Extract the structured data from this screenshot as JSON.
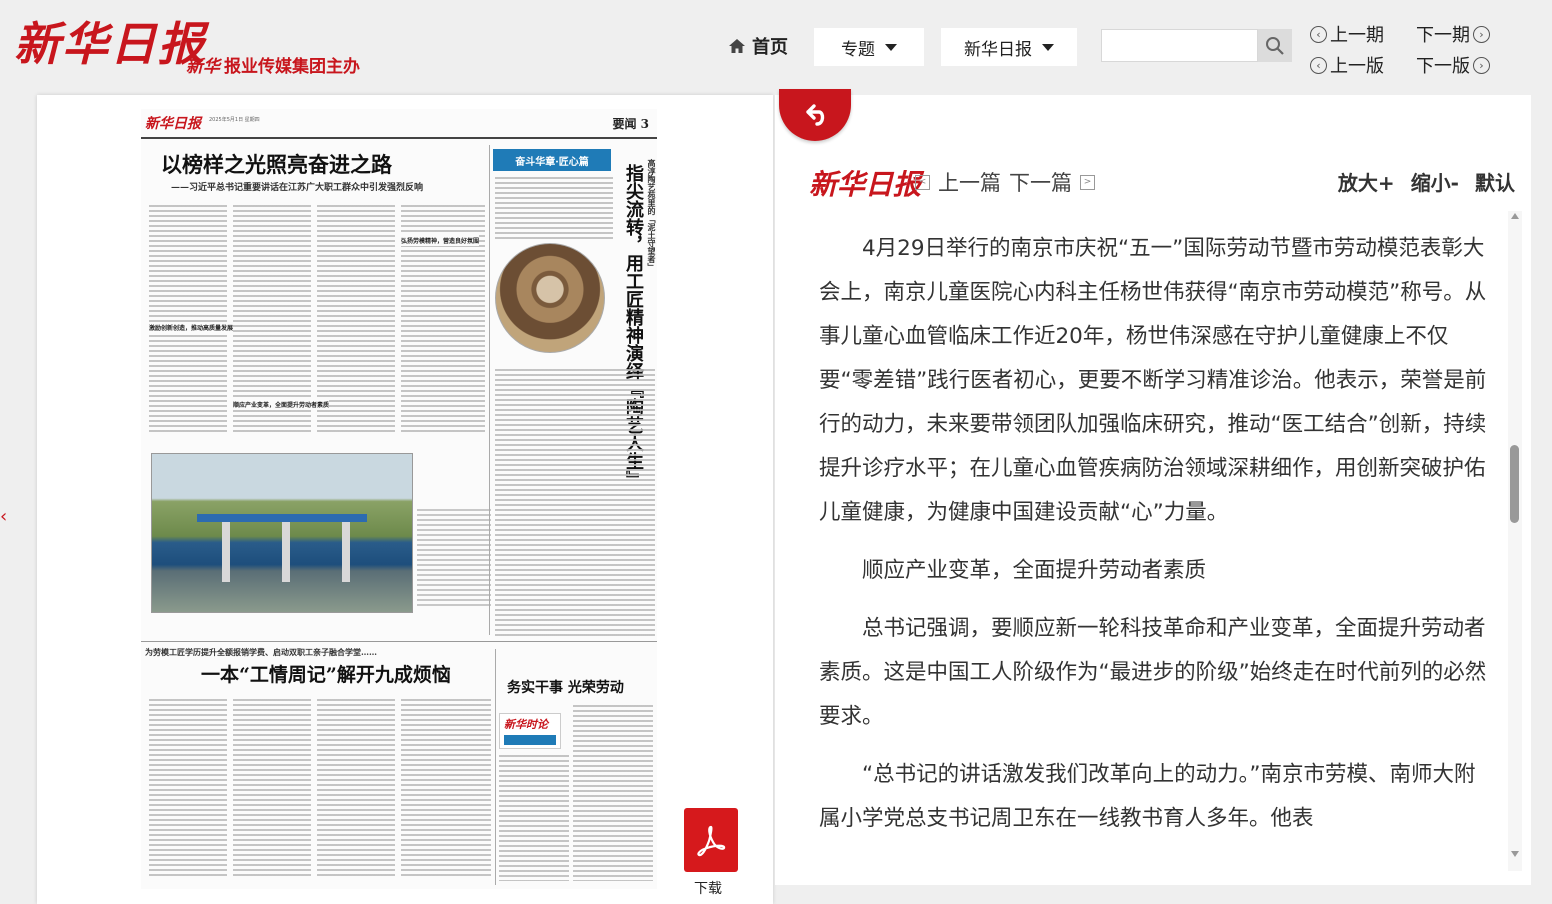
{
  "header": {
    "logo": "新华日报",
    "sub_logo_mark": "新华",
    "sub_logo": "报业传媒集团主办",
    "home_label": "首页",
    "topic_label": "专题",
    "paper_label": "新华日报",
    "search_placeholder": "",
    "prev_issue": "上一期",
    "next_issue": "下一期",
    "prev_page": "上一版",
    "next_page": "下一版"
  },
  "paper": {
    "logo": "新华日报",
    "date_line": "2025年5月1日 星期四",
    "section": "要闻  3",
    "title1": "以榜样之光照亮奋进之路",
    "subtitle1": "——习近平总书记重要讲话在江苏广大职工群众中引发强烈反响",
    "subhead1": "激励创新创造，推动高质量发展",
    "subhead2": "顺应产业变革，全面提升劳动者素质",
    "subhead3": "弘扬劳模精神，营造良好氛围",
    "banner": "奋斗华章·匠心篇",
    "vtitle": "指尖流转，用工匠精神演绎『陶艺人生』",
    "vsub": "高淳陶艺苑里的「泥土守望者」",
    "title2_pre": "为劳模工匠学历提升全额报销学费、启动双职工亲子融合学堂……",
    "title2": "一本“工情周记”解开九成烦恼",
    "title3": "务实干事 光荣劳动",
    "badge": "新华时论"
  },
  "download_label": "下载",
  "reader": {
    "logo": "新华日报",
    "prev_article": "上一篇",
    "next_article": "下一篇",
    "zoom_in": "放大+",
    "zoom_out": "缩小-",
    "zoom_default": "默认",
    "paragraphs": [
      "4月29日举行的南京市庆祝“五一”国际劳动节暨市劳动模范表彰大会上，南京儿童医院心内科主任杨世伟获得“南京市劳动模范”称号。从事儿童心血管临床工作近20年，杨世伟深感在守护儿童健康上不仅要“零差错”践行医者初心，更要不断学习精准诊治。他表示，荣誉是前行的动力，未来要带领团队加强临床研究，推动“医工结合”创新，持续提升诊疗水平；在儿童心血管疾病防治领域深耕细作，用创新突破护佑儿童健康，为健康中国建设贡献“心”力量。",
      "顺应产业变革，全面提升劳动者素质",
      "总书记强调，要顺应新一轮科技革命和产业变革，全面提升劳动者素质。这是中国工人阶级作为“最进步的阶级”始终走在时代前列的必然要求。",
      "“总书记的讲话激发我们改革向上的动力。”南京市劳模、南师大附属小学党总支书记周卫东在一线教书育人多年。他表"
    ]
  },
  "colors": {
    "brand_red": "#c8161d",
    "accent_blue": "#1f7bb7"
  }
}
